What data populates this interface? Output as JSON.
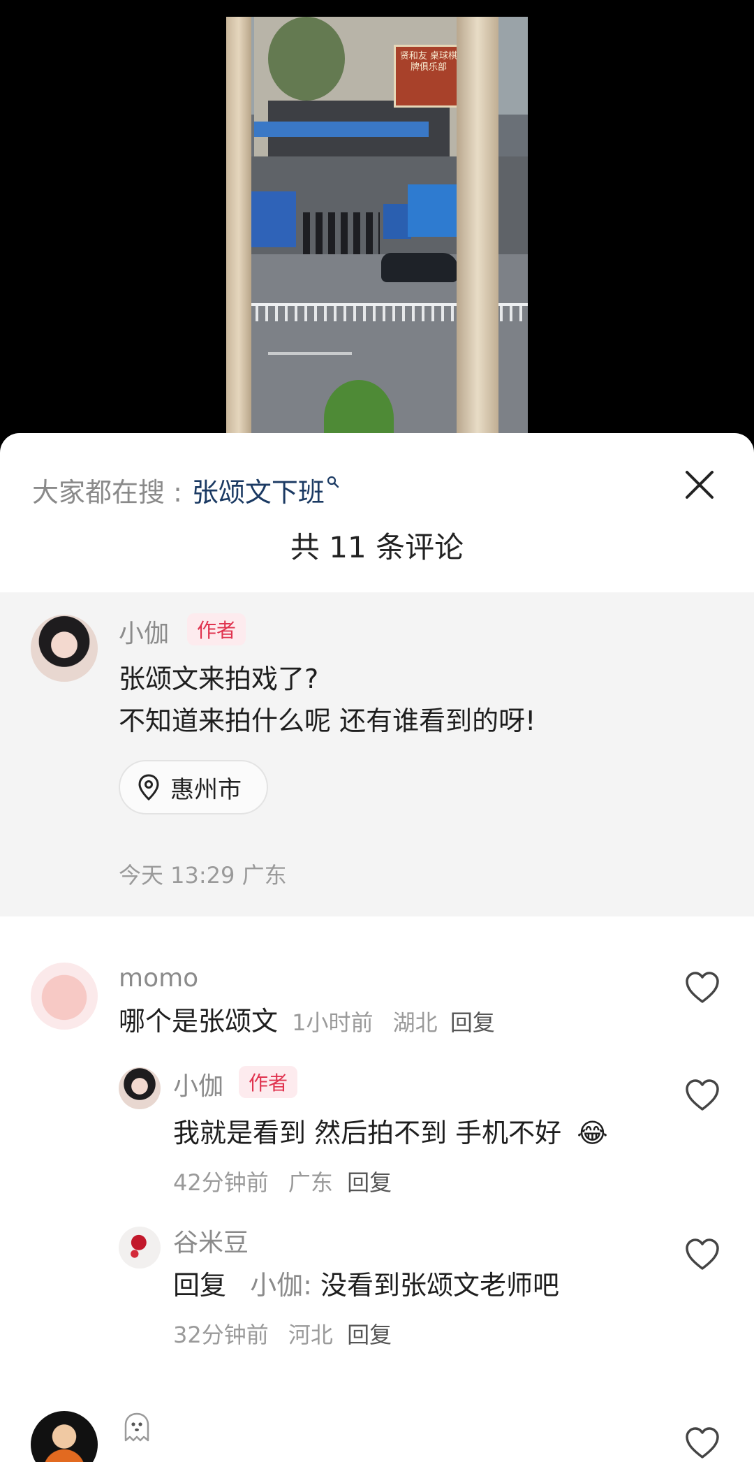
{
  "video": {
    "sign_text": "贤和友 桌球棋牌俱乐部"
  },
  "sheet": {
    "search_prefix": "大家都在搜 :",
    "search_term": "张颂文下班",
    "title": "共 11 条评论"
  },
  "post": {
    "author": "小伽",
    "author_tag": "作者",
    "line1": "张颂文来拍戏了?",
    "line2": "不知道来拍什么呢  还有谁看到的呀!",
    "location": "惠州市",
    "meta": "今天 13:29  广东"
  },
  "comments": [
    {
      "name": "momo",
      "text": "哪个是张颂文",
      "time": "1小时前",
      "region": "湖北",
      "reply_label": "回复"
    }
  ],
  "replies": [
    {
      "name": "小伽",
      "tag": "作者",
      "text": "我就是看到 然后拍不到 手机不好",
      "emoji": "😂",
      "time": "42分钟前",
      "region": "广东",
      "reply_label": "回复"
    },
    {
      "name": "谷米豆",
      "reply_prefix": "回复",
      "reply_to": "小伽:",
      "text": "没看到张颂文老师吧",
      "time": "32分钟前",
      "region": "河北",
      "reply_label": "回复"
    }
  ],
  "icons": {
    "close": "close-icon",
    "heart": "heart-icon",
    "location": "location-pin-icon",
    "ghost": "ghost-icon"
  }
}
